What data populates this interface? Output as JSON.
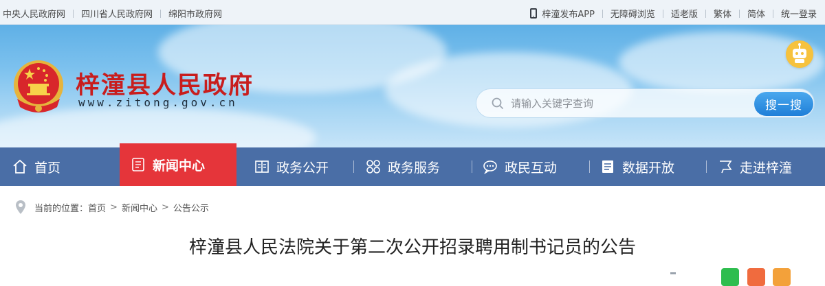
{
  "topbar": {
    "left_links": [
      "中央人民政府网",
      "四川省人民政府网",
      "绵阳市政府网"
    ],
    "right_links": [
      "梓潼发布APP",
      "无障碍浏览",
      "适老版",
      "繁体",
      "简体",
      "统一登录"
    ],
    "icon_app": "phone-icon"
  },
  "header": {
    "site_name": "梓潼县人民政府",
    "site_url": "www.zitong.gov.cn",
    "emblem_icon": "national-emblem-icon",
    "robot_icon": "robot-assistant-icon"
  },
  "search": {
    "placeholder": "请输入关键字查询",
    "value": "",
    "button_label": "搜一搜"
  },
  "nav": {
    "items": [
      {
        "label": "首页",
        "icon": "home-icon"
      },
      {
        "label": "新闻中心",
        "icon": "document-icon",
        "active": true
      },
      {
        "label": "政务公开",
        "icon": "book-icon"
      },
      {
        "label": "政务服务",
        "icon": "grid-icon"
      },
      {
        "label": "政民互动",
        "icon": "chat-icon"
      },
      {
        "label": "数据开放",
        "icon": "data-icon"
      },
      {
        "label": "走进梓潼",
        "icon": "flag-icon"
      }
    ]
  },
  "breadcrumb": {
    "prefix": "当前的位置：",
    "items": [
      "首页",
      "新闻中心",
      "公告公示"
    ],
    "separator": ">"
  },
  "article": {
    "title": "梓潼县人民法院关于第二次公开招录聘用制书记员的公告"
  },
  "colors": {
    "nav_bg": "#4a6ea6",
    "nav_active": "#e5353a",
    "site_name": "#c81d1d",
    "search_button": "#1f7fd8"
  }
}
